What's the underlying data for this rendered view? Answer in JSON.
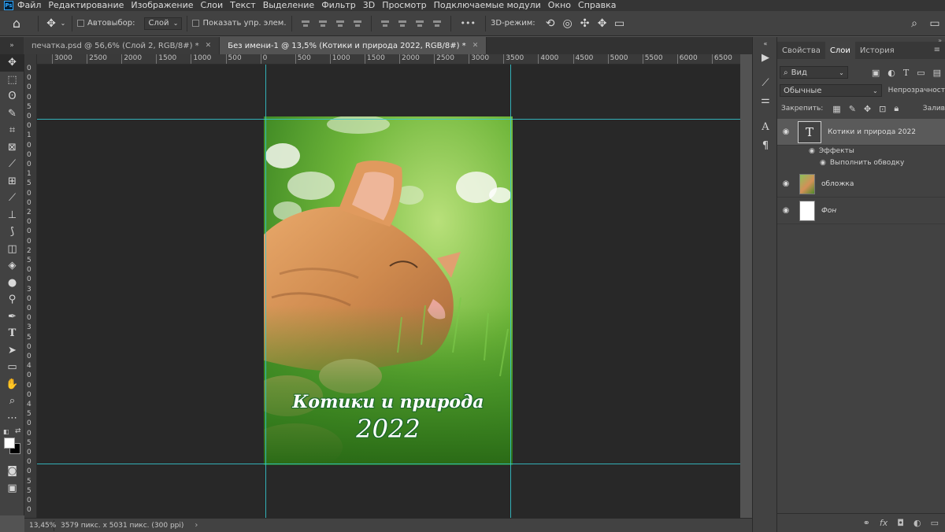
{
  "menubar": {
    "app_logo": "Ps",
    "items": [
      "Файл",
      "Редактирование",
      "Изображение",
      "Слои",
      "Текст",
      "Выделение",
      "Фильтр",
      "3D",
      "Просмотр",
      "Подключаемые модули",
      "Окно",
      "Справка"
    ]
  },
  "options": {
    "autoselect_label": "Автовыбор:",
    "autoselect_value": "Слой",
    "show_controls_label": "Показать упр. элем.",
    "more_label": "•••",
    "mode3d_label": "3D-режим:"
  },
  "tabs": [
    {
      "label": "печатка.psd @ 56,6% (Слой 2, RGB/8#) *",
      "close": "✕",
      "active": false
    },
    {
      "label": "Без имени-1 @ 13,5% (Котики и природа 2022, RGB/8#) *",
      "close": "✕",
      "active": true
    }
  ],
  "rulers": {
    "horizontal": [
      "3000",
      "2500",
      "2000",
      "1500",
      "1000",
      "500",
      "0",
      "500",
      "1000",
      "1500",
      "2000",
      "2500",
      "3000",
      "3500",
      "4000",
      "4500",
      "5000",
      "5500",
      "6000",
      "6500"
    ],
    "vertical_chars": [
      "0",
      "0",
      "0",
      "0",
      "5",
      "0",
      "0",
      "1",
      "0",
      "0",
      "0",
      "1",
      "5",
      "0",
      "0",
      "2",
      "0",
      "0",
      "0",
      "2",
      "5",
      "0",
      "0",
      "3",
      "0",
      "0",
      "0",
      "3",
      "5",
      "0",
      "0",
      "4",
      "0",
      "0",
      "0",
      "4",
      "5",
      "0",
      "0",
      "5",
      "0",
      "0",
      "0",
      "5",
      "5",
      "0",
      "0"
    ]
  },
  "canvas": {
    "title_line1": "Котики и природа",
    "title_line2": "2022"
  },
  "status": {
    "zoom": "13,45%",
    "doc_info": "3579 пикс. x 5031 пикс. (300 ppi)",
    "arrow": "›"
  },
  "panel": {
    "tabs": [
      "Свойства",
      "Слои",
      "История"
    ],
    "active_tab": "Слои",
    "filter_label": "Вид",
    "blend_mode": "Обычные",
    "opacity_label": "Непрозрачност",
    "lock_label": "Закрепить:",
    "fill_label": "Залив",
    "layers": [
      {
        "name": "Котики и природа 2022",
        "type": "text",
        "selected": true
      },
      {
        "name": "обложка",
        "type": "image",
        "selected": false
      },
      {
        "name": "Фон",
        "type": "background",
        "selected": false
      }
    ],
    "effects_label": "Эффекты",
    "stroke_label": "Выполнить обводку"
  },
  "colors": {
    "guide": "#35c8d0",
    "canvas_bg": "#282828",
    "ui_bg": "#424242",
    "accent": "#31a8ff"
  }
}
